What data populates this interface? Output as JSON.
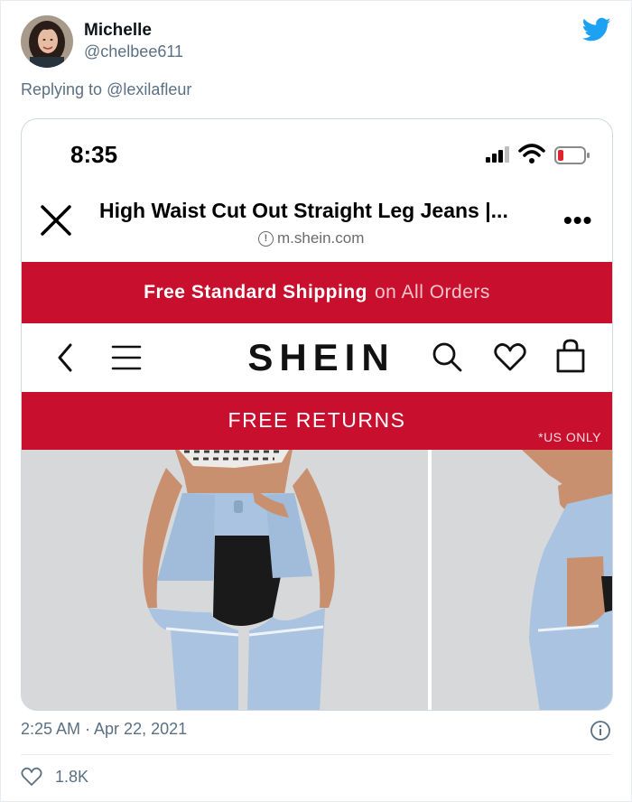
{
  "user": {
    "name": "Michelle",
    "handle": "@chelbee611"
  },
  "reply": {
    "prefix": "Replying to",
    "mention": "@lexilafleur"
  },
  "phone": {
    "time": "8:35",
    "page_title": "High Waist Cut Out Straight Leg Jeans |...",
    "url": "m.shein.com",
    "more": "•••"
  },
  "shop": {
    "shipping_strong": "Free Standard Shipping",
    "shipping_light": "on All Orders",
    "logo": "SHEIN",
    "returns": "FREE RETURNS",
    "returns_note": "*US ONLY"
  },
  "footer": {
    "timestamp": "2:25 AM · Apr 22, 2021",
    "likes": "1.8K"
  },
  "colors": {
    "brand_red": "#c8102e",
    "twitter_blue": "#1da1f2",
    "muted_text": "#5b7083",
    "battery_low": "#e0242b"
  },
  "icons": [
    "twitter-bird-icon",
    "close-icon",
    "info-icon",
    "signal-icon",
    "wifi-icon",
    "battery-icon",
    "back-chevron-icon",
    "hamburger-menu-icon",
    "search-icon",
    "heart-icon",
    "shopping-bag-icon",
    "like-heart-icon"
  ]
}
